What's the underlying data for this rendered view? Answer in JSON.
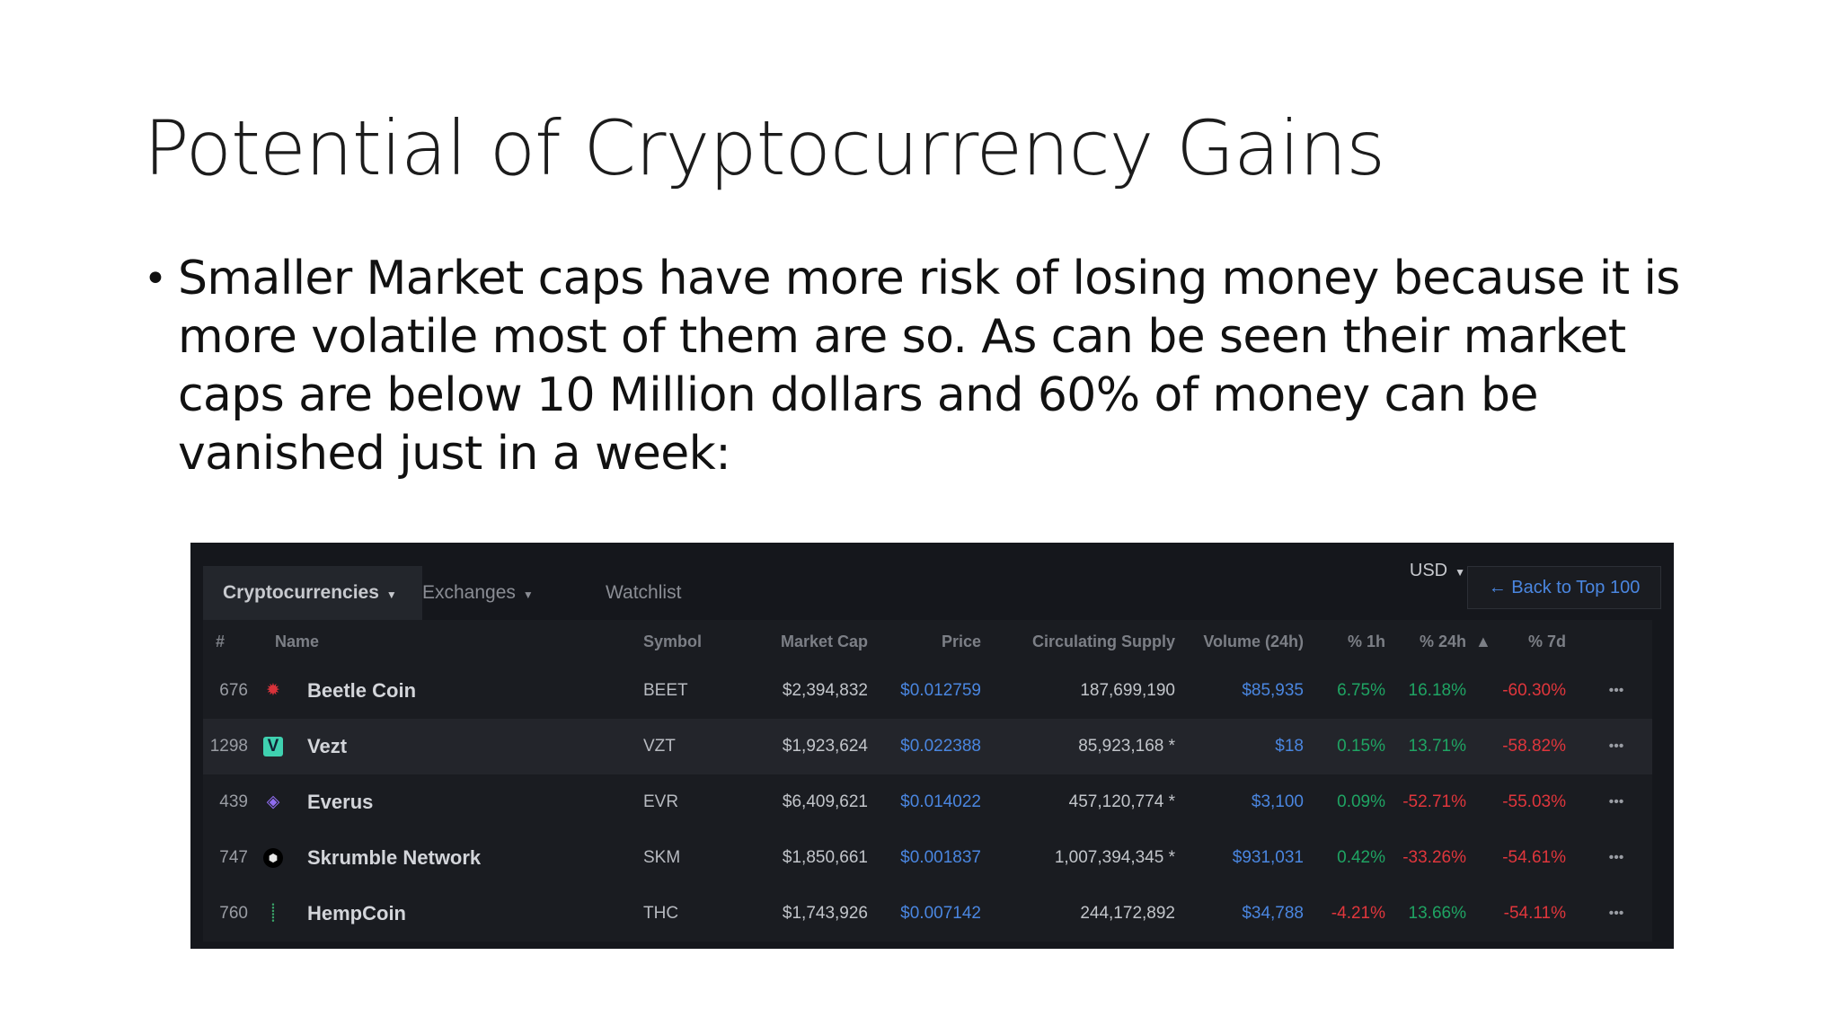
{
  "slide": {
    "title": "Potential of Cryptocurrency Gains",
    "bullet": "Smaller Market caps have more risk of losing money because it is more volatile most of them are so. As can be seen their market caps are below 10 Million dollars and 60% of money can be vanished just in a week:"
  },
  "screenshot": {
    "tabs": [
      "Cryptocurrencies",
      "Exchanges",
      "Watchlist"
    ],
    "currency": "USD",
    "back_link": "← Back to Top 100",
    "columns": [
      "#",
      "Name",
      "Symbol",
      "Market Cap",
      "Price",
      "Circulating Supply",
      "Volume (24h)",
      "% 1h",
      "% 24h",
      "% 7d"
    ],
    "more_icon": "•••",
    "rows": [
      {
        "rank": "676",
        "name": "Beetle Coin",
        "symbol": "BEET",
        "market_cap": "$2,394,832",
        "price": "$0.012759",
        "supply": "187,699,190",
        "volume": "$85,935",
        "h1": "6.75%",
        "h24": "16.18%",
        "d7": "-60.30%",
        "icon": "bug-icon",
        "icon_glyph": "✹",
        "icon_color": "#d8323a"
      },
      {
        "rank": "1298",
        "name": "Vezt",
        "symbol": "VZT",
        "market_cap": "$1,923,624",
        "price": "$0.022388",
        "supply": "85,923,168 *",
        "volume": "$18",
        "h1": "0.15%",
        "h24": "13.71%",
        "d7": "-58.82%",
        "icon": "vezt-logo-icon",
        "icon_glyph": "V",
        "icon_color": "#3fd1b0"
      },
      {
        "rank": "439",
        "name": "Everus",
        "symbol": "EVR",
        "market_cap": "$6,409,621",
        "price": "$0.014022",
        "supply": "457,120,774 *",
        "volume": "$3,100",
        "h1": "0.09%",
        "h24": "-52.71%",
        "d7": "-55.03%",
        "icon": "everus-logo-icon",
        "icon_glyph": "◈",
        "icon_color": "#8f6df0"
      },
      {
        "rank": "747",
        "name": "Skrumble Network",
        "symbol": "SKM",
        "market_cap": "$1,850,661",
        "price": "$0.001837",
        "supply": "1,007,394,345 *",
        "volume": "$931,031",
        "h1": "0.42%",
        "h24": "-33.26%",
        "d7": "-54.61%",
        "icon": "skrumble-logo-icon",
        "icon_glyph": "⬢",
        "icon_color": "#e6e6e6"
      },
      {
        "rank": "760",
        "name": "HempCoin",
        "symbol": "THC",
        "market_cap": "$1,743,926",
        "price": "$0.007142",
        "supply": "244,172,892",
        "volume": "$34,788",
        "h1": "-4.21%",
        "h24": "13.66%",
        "d7": "-54.11%",
        "icon": "hempcoin-logo-icon",
        "icon_glyph": "⸽",
        "icon_color": "#3aa66a"
      }
    ]
  }
}
